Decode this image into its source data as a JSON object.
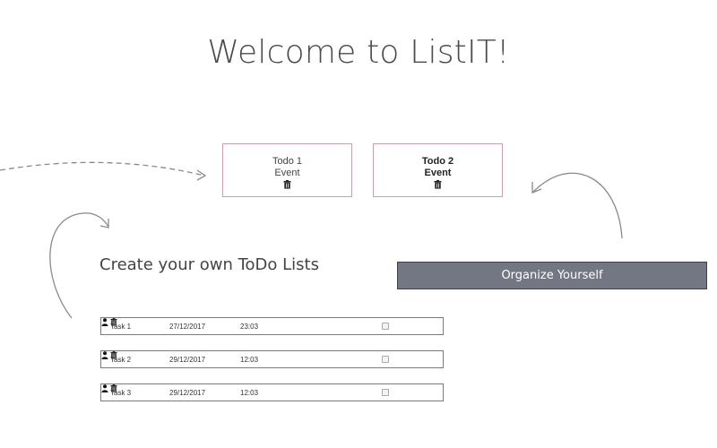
{
  "header": {
    "title": "Welcome to ListIT!"
  },
  "cards": [
    {
      "line1": "Todo 1",
      "line2": "Event",
      "icon": "trash-icon"
    },
    {
      "line1": "Todo 2",
      "line2": "Event",
      "icon": "trash-icon"
    }
  ],
  "section": {
    "subtitle": "Create your own ToDo Lists"
  },
  "organize_button": {
    "label": "Organize Yourself",
    "color": "#737783"
  },
  "tasks": [
    {
      "name": "Task 1",
      "date": "27/12/2017",
      "time": "23:03"
    },
    {
      "name": "Task 2",
      "date": "29/12/2017",
      "time": "12:03"
    },
    {
      "name": "Task 3",
      "date": "29/12/2017",
      "time": "12:03"
    }
  ],
  "colors": {
    "card_border": "#c9a0a7",
    "arrow": "#8a8a8a"
  }
}
